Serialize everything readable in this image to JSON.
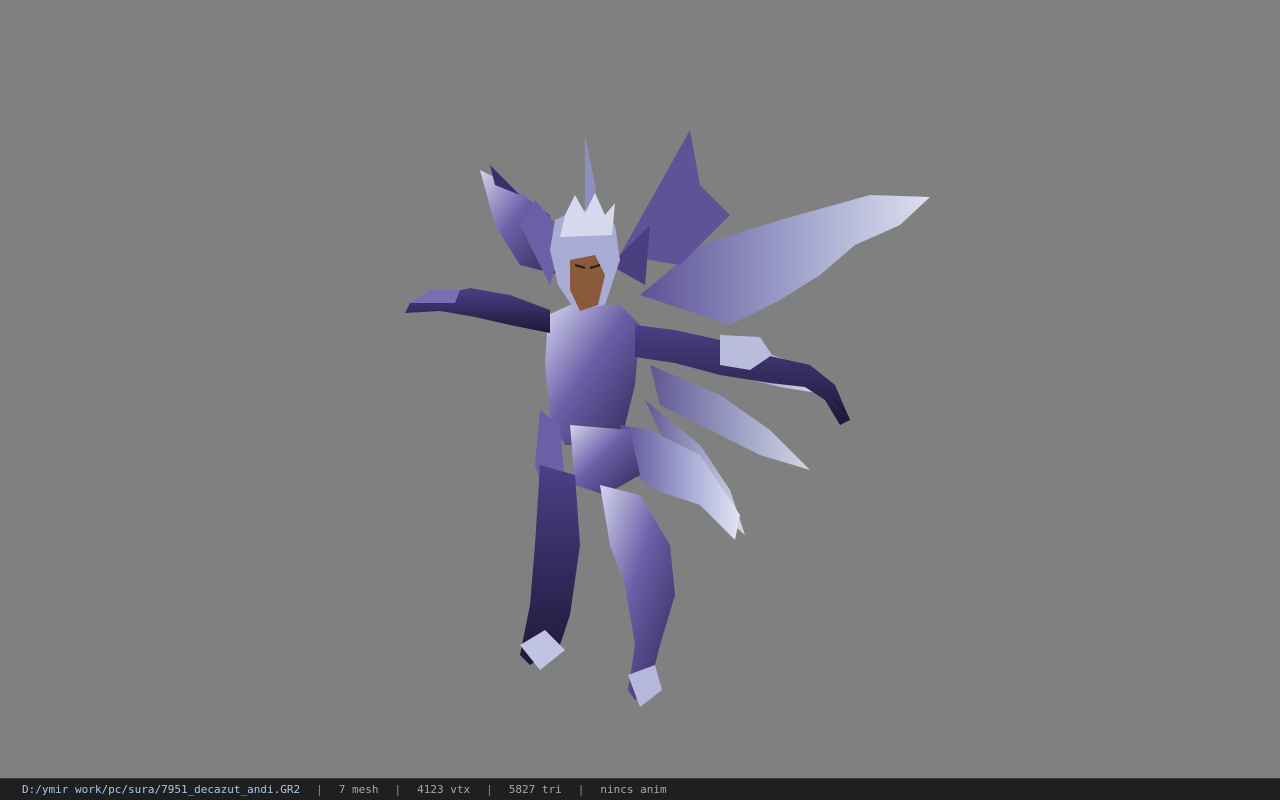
{
  "viewport": {
    "background": "#808080",
    "model_name": "7951_decazut_andi.GR2"
  },
  "statusbar": {
    "file_path": "D:/ymir work/pc/sura/7951_decazut_andi.GR2",
    "separator": "|",
    "mesh_count": "7 mesh",
    "vertex_count": "4123 vtx",
    "triangle_count": "5827 tri",
    "animation": "nincs anim"
  },
  "colors": {
    "armor_dark": "#3b2f66",
    "armor_mid": "#6c5fa8",
    "armor_light": "#c9cbe6",
    "skin": "#8a5a3c",
    "statusbar_bg": "#1f1f1f"
  }
}
